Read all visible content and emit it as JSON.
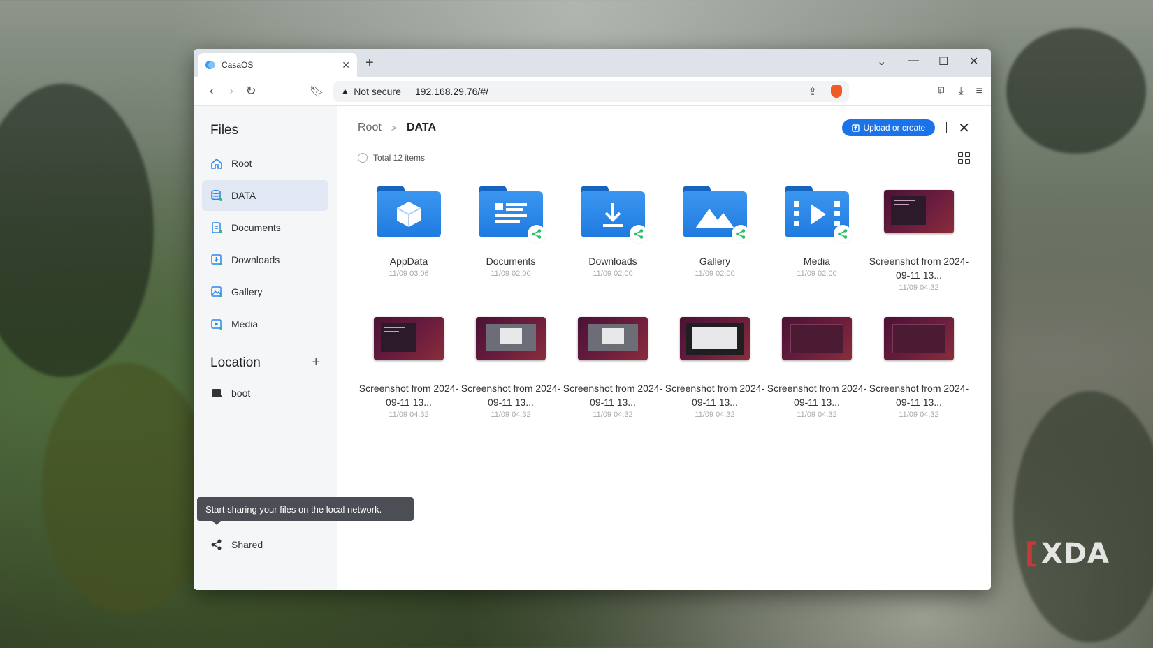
{
  "browser": {
    "tab_title": "CasaOS",
    "not_secure": "Not secure",
    "url": "192.168.29.76/#/"
  },
  "watermark": "XDA",
  "sidebar": {
    "files_title": "Files",
    "items": [
      {
        "label": "Root",
        "icon": "home-icon"
      },
      {
        "label": "DATA",
        "icon": "database-icon",
        "active": true
      },
      {
        "label": "Documents",
        "icon": "documents-icon"
      },
      {
        "label": "Downloads",
        "icon": "downloads-icon"
      },
      {
        "label": "Gallery",
        "icon": "gallery-icon"
      },
      {
        "label": "Media",
        "icon": "media-icon"
      }
    ],
    "location_title": "Location",
    "locations": [
      {
        "label": "boot",
        "icon": "drive-icon"
      }
    ],
    "tooltip": "Start sharing your files on the local network.",
    "shared_label": "Shared"
  },
  "main": {
    "breadcrumb": {
      "root": "Root",
      "separator": ">",
      "current": "DATA"
    },
    "upload_label": "Upload or create",
    "total": "Total 12 items",
    "items": [
      {
        "name": "AppData",
        "date": "11/09 03:06",
        "kind": "folder",
        "glyph": "cube",
        "shared": false
      },
      {
        "name": "Documents",
        "date": "11/09 02:00",
        "kind": "folder",
        "glyph": "doc",
        "shared": true
      },
      {
        "name": "Downloads",
        "date": "11/09 02:00",
        "kind": "folder",
        "glyph": "download",
        "shared": true
      },
      {
        "name": "Gallery",
        "date": "11/09 02:00",
        "kind": "folder",
        "glyph": "image",
        "shared": true
      },
      {
        "name": "Media",
        "date": "11/09 02:00",
        "kind": "folder",
        "glyph": "play",
        "shared": true
      },
      {
        "name": "Screenshot from 2024-09-11 13...",
        "date": "11/09 04:32",
        "kind": "shot",
        "variant": "terminal"
      },
      {
        "name": "Screenshot from 2024-09-11 13...",
        "date": "11/09 04:32",
        "kind": "shot",
        "variant": "terminal"
      },
      {
        "name": "Screenshot from 2024-09-11 13...",
        "date": "11/09 04:32",
        "kind": "shot",
        "variant": "dialog"
      },
      {
        "name": "Screenshot from 2024-09-11 13...",
        "date": "11/09 04:32",
        "kind": "shot",
        "variant": "dialog"
      },
      {
        "name": "Screenshot from 2024-09-11 13...",
        "date": "11/09 04:32",
        "kind": "shot",
        "variant": "light"
      },
      {
        "name": "Screenshot from 2024-09-11 13...",
        "date": "11/09 04:32",
        "kind": "shot",
        "variant": "dark"
      },
      {
        "name": "Screenshot from 2024-09-11 13...",
        "date": "11/09 04:32",
        "kind": "shot",
        "variant": "dark"
      }
    ]
  },
  "colors": {
    "accent": "#1a73e8",
    "folder": "#2b87ea",
    "share_badge": "#2bbf6a"
  }
}
